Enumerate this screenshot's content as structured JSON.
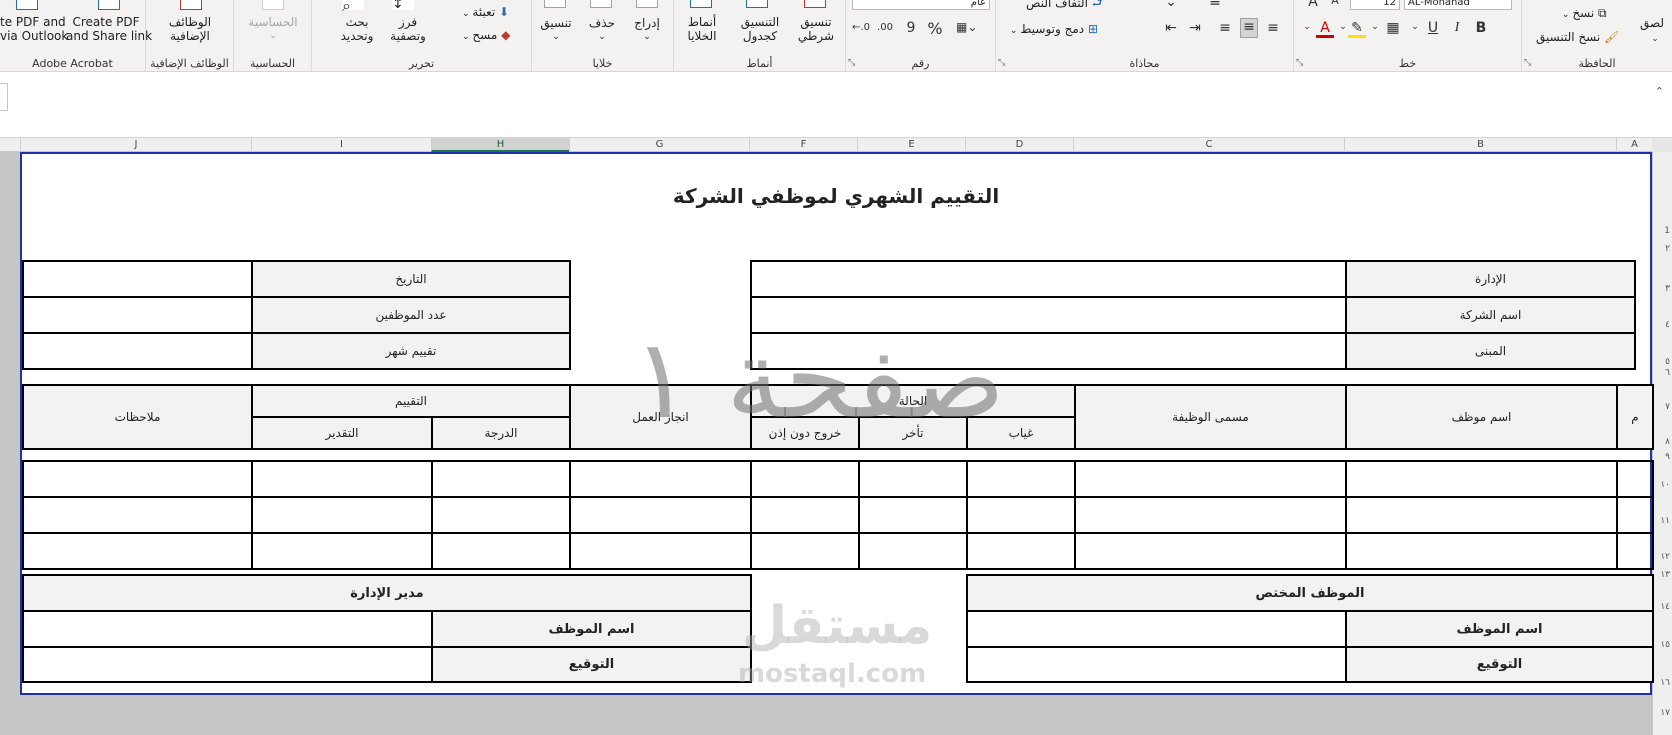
{
  "ribbon": {
    "acrobat": {
      "btn1_line1": "te PDF and",
      "btn1_line2": "via Outlook",
      "btn2_line1": "Create PDF",
      "btn2_line2": "and Share link",
      "label": "Adobe Acrobat"
    },
    "addins": {
      "btn_line1": "الوظائف",
      "btn_line2": "الإضافية",
      "label": "الوظائف الإضافية"
    },
    "sensitivity": {
      "btn": "الحساسية",
      "label": "الحساسية"
    },
    "editing": {
      "find_line1": "بحث",
      "find_line2": "وتحديد",
      "sort_line1": "فرز",
      "sort_line2": "وتصفية",
      "fill": "تعبئة",
      "clear": "مسح",
      "label": "تحرير"
    },
    "cells": {
      "format": "تنسيق",
      "delete": "حذف",
      "insert": "إدراج",
      "label": "خلايا"
    },
    "styles": {
      "cellstyles_line1": "أنماط",
      "cellstyles_line2": "الخلايا",
      "table_line1": "التنسيق",
      "table_line2": "كجدول",
      "cond_line1": "تنسيق",
      "cond_line2": "شرطي",
      "label": "أنماط"
    },
    "number": {
      "format_value": "عام",
      "percent": "%",
      "comma": "9",
      "label": "رقم"
    },
    "alignment": {
      "wrap": "التفاف النص",
      "merge": "دمج وتوسيط",
      "label": "محاذاة"
    },
    "font": {
      "size": "12",
      "name": "AL-Mohanad",
      "bold": "B",
      "italic": "I",
      "underline": "U",
      "color_a": "A",
      "label": "خط"
    },
    "clipboard": {
      "copy": "نسخ",
      "format_painter": "نسخ التنسيق",
      "paste": "لصق",
      "label": "الحافظة"
    }
  },
  "columns": [
    "J",
    "I",
    "H",
    "G",
    "F",
    "E",
    "D",
    "C",
    "B",
    "A"
  ],
  "rows": [
    "1",
    "٢",
    "٣",
    "٤",
    "٥",
    "٦",
    "٧",
    "٨",
    "٩",
    "١٠",
    "١١",
    "١٢",
    "١٣",
    "١٤",
    "١٥",
    "١٦",
    "١٧"
  ],
  "sheet": {
    "title": "التقييم الشهري لموظفي الشركة",
    "info_right": {
      "dept": "الإدارة",
      "company": "اسم الشركة",
      "building": "المبنى"
    },
    "info_left": {
      "date": "التاريخ",
      "employees_count": "عدد الموظفين",
      "month_eval": "تقييم شهر"
    },
    "table_headers": {
      "num": "م",
      "emp_name": "اسم موظف",
      "job_title": "مسمى الوظيفة",
      "status": "الحالة",
      "absence": "غياب",
      "late": "تأخر",
      "exit_no_permission": "خروج دون إذن",
      "achievement": "انجاز العمل",
      "evaluation": "التقييم",
      "grade": "الدرجة",
      "rating": "التقدير",
      "notes": "ملاحظات"
    },
    "signatures": {
      "right_header": "الموظف المختص",
      "right_name": "اسم الموظف",
      "right_sign": "التوقيع",
      "left_header": "مدير الإدارة",
      "left_name": "اسم الموظف",
      "left_sign": "التوقيع"
    },
    "page_watermark": "صفحة ١",
    "site_watermark_ar": "مستقل",
    "site_watermark_en": "mostaql.com"
  }
}
